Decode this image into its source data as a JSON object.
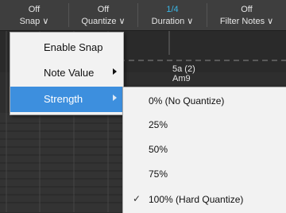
{
  "toolbar": {
    "snap": {
      "value": "Off",
      "label": "Snap ∨"
    },
    "quantize": {
      "value": "Off",
      "label": "Quantize ∨"
    },
    "duration": {
      "value": "1/4",
      "label": "Duration ∨"
    },
    "filter_notes": {
      "value": "Off",
      "label": "Filter Notes ∨"
    },
    "accent_color": "#39b6e6"
  },
  "editor": {
    "chord_label_line1": "5a (2)",
    "chord_label_line2": "Am9"
  },
  "menu": {
    "items": [
      {
        "label": "Enable Snap",
        "has_submenu": false
      },
      {
        "label": "Note Value",
        "has_submenu": true
      },
      {
        "label": "Strength",
        "has_submenu": true,
        "highlighted": true
      }
    ],
    "highlight_color": "#3d8fde"
  },
  "strength_submenu": {
    "items": [
      {
        "label": "0% (No Quantize)",
        "checked": false
      },
      {
        "label": "25%",
        "checked": false
      },
      {
        "label": "50%",
        "checked": false
      },
      {
        "label": "75%",
        "checked": false
      },
      {
        "label": "100% (Hard Quantize)",
        "checked": true
      }
    ],
    "check_glyph": "✓"
  }
}
